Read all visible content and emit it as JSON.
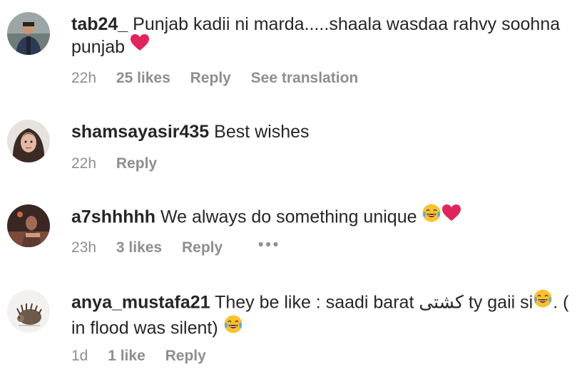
{
  "comments": [
    {
      "username": "tab24_",
      "text": "Punjab kadii ni marda.....shaala wasdaa rahvy soohna punjab",
      "emoji_after": "red-heart",
      "time": "22h",
      "likes": "25 likes",
      "reply": "Reply",
      "translation": "See translation"
    },
    {
      "username": "shamsayasir435",
      "text": "Best wishes",
      "time": "22h",
      "reply": "Reply"
    },
    {
      "username": "a7shhhhh",
      "text": "We always do something unique",
      "emoji_after": "laughing-tears + red-heart",
      "time": "23h",
      "likes": "3 likes",
      "reply": "Reply",
      "more": "•••"
    },
    {
      "username": "anya_mustafa21",
      "text_before": "They be like : saadi barat ",
      "text_urdu": "کشتی",
      "text_mid": " ty gaii si",
      "text_after": ". ( in flood was silent)",
      "time": "1d",
      "likes": "1 like",
      "reply": "Reply"
    }
  ],
  "colors": {
    "text": "#262626",
    "meta": "#8e8e8e",
    "heart": "#e0245e",
    "emoji_face": "#f7c232"
  }
}
